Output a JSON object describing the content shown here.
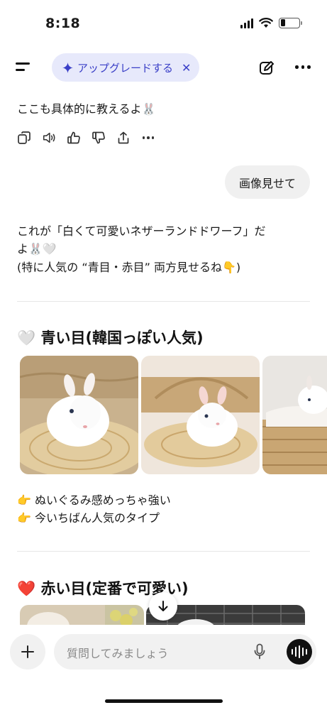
{
  "status_bar": {
    "time": "8:18"
  },
  "header": {
    "upgrade_label": "アップグレードする",
    "close_symbol": "✕"
  },
  "messages": {
    "assistant_prev_text": "ここも具体的に教えるよ🐰",
    "user_text": "画像見せて",
    "assistant_line1": "これが「白くて可愛いネザーランドドワーフ」だ",
    "assistant_line2": "よ🐰🤍",
    "assistant_line3": "(特に人気の “青目・赤目” 両方見せるね👇)"
  },
  "sections": [
    {
      "title": "🤍 青い目(韓国っぽい人気)",
      "bullets": [
        "👉 ぬいぐるみ感めっちゃ強い",
        "👉 今いちばん人気のタイプ"
      ]
    },
    {
      "title": "❤️ 赤い目(定番で可愛い)"
    }
  ],
  "composer": {
    "placeholder": "質問してみましょう"
  },
  "colors": {
    "accent": "#3a3fc7",
    "pill_bg": "#e7e9fb",
    "bubble_bg": "#f0f0f0"
  }
}
